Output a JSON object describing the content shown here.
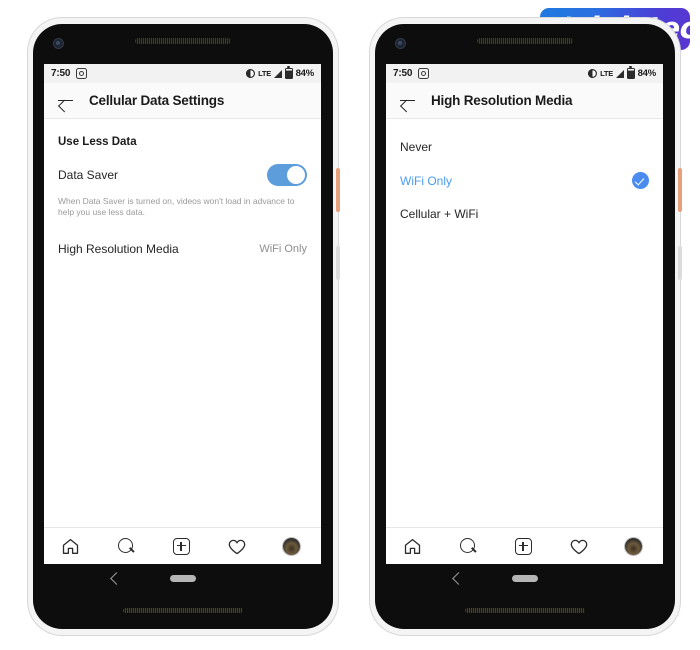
{
  "logo": {
    "text": "igiatech",
    "lead_letter": "D",
    "colors": {
      "gradient_start": "#1f7ae0",
      "gradient_end": "#5b35d0",
      "text": "#ffffff"
    }
  },
  "status_bar": {
    "time": "7:50",
    "app_icon": "instagram-icon",
    "dnd_icon": "half-circle-icon",
    "network": "LTE",
    "signal_icon": "signal-bars-icon",
    "battery_icon": "battery-icon",
    "battery_percent": "84%"
  },
  "phones": [
    {
      "id": "left",
      "appbar": {
        "back_icon": "back-arrow-icon",
        "title": "Cellular Data Settings"
      },
      "section": {
        "header": "Use Less Data"
      },
      "data_saver": {
        "label": "Data Saver",
        "toggle_state": "on",
        "toggle_color": "#5d9ddb",
        "helper": "When Data Saver is turned on, videos won't load in advance to help you use less data."
      },
      "high_res": {
        "label": "High Resolution Media",
        "value": "WiFi Only"
      }
    },
    {
      "id": "right",
      "appbar": {
        "back_icon": "back-arrow-icon",
        "title": "High Resolution Media"
      },
      "options": [
        {
          "label": "Never",
          "selected": false
        },
        {
          "label": "WiFi Only",
          "selected": true
        },
        {
          "label": "Cellular + WiFi",
          "selected": false
        }
      ],
      "selected_color": "#4a9cf0",
      "check_icon": "check-circle-icon"
    }
  ],
  "tabbar": {
    "items": [
      {
        "icon": "home-icon"
      },
      {
        "icon": "search-icon"
      },
      {
        "icon": "add-post-icon"
      },
      {
        "icon": "heart-icon"
      },
      {
        "icon": "profile-avatar-icon"
      }
    ]
  },
  "android_nav": {
    "back_icon": "nav-back-icon",
    "home_pill": "nav-home-pill"
  }
}
